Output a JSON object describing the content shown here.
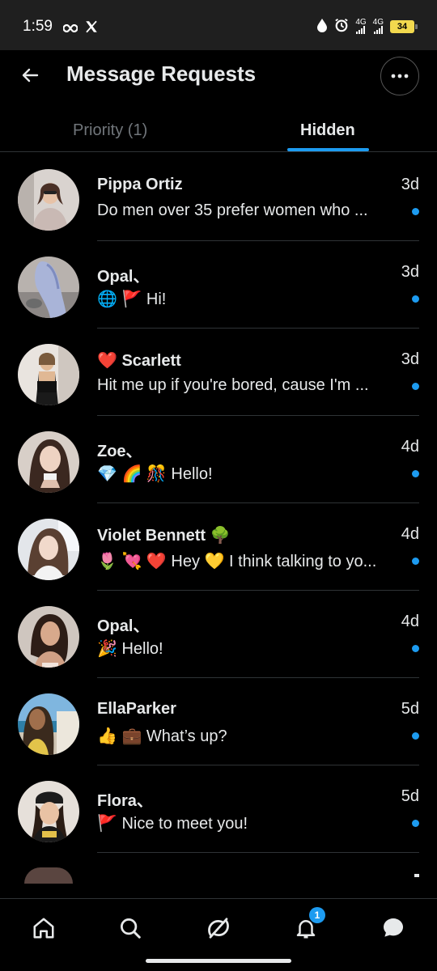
{
  "status_bar": {
    "time": "1:59",
    "network_1": "4G",
    "network_2": "4G",
    "battery": "34"
  },
  "header": {
    "title": "Message Requests"
  },
  "tabs": [
    {
      "label": "Priority (1)",
      "selected": false
    },
    {
      "label": "Hidden",
      "selected": true
    }
  ],
  "accent_color": "#1d9bf0",
  "messages": [
    {
      "name": "Pippa Ortiz",
      "time": "3d",
      "preview": "Do men over 35 prefer women who ...",
      "unread": true
    },
    {
      "name": "Opal、",
      "time": "3d",
      "preview": "🌐 🚩 Hi!",
      "unread": true
    },
    {
      "name": "❤️ Scarlett",
      "time": "3d",
      "preview": "Hit me up if you're bored, cause I'm ...",
      "unread": true
    },
    {
      "name": "Zoe、",
      "time": "4d",
      "preview": "💎 🌈 🎊 Hello!",
      "unread": true
    },
    {
      "name": "Violet Bennett 🌳",
      "time": "4d",
      "preview": "🌷 💘 ❤️ Hey 💛 I think talking to yo...",
      "unread": true
    },
    {
      "name": "Opal、",
      "time": "4d",
      "preview": "🎉 Hello!",
      "unread": true
    },
    {
      "name": "EllaParker",
      "time": "5d",
      "preview": "👍 💼 What’s up?",
      "unread": true
    },
    {
      "name": "Flora、",
      "time": "5d",
      "preview": "🚩 Nice to meet you!",
      "unread": true
    }
  ],
  "bottom_nav": {
    "items": [
      "home-icon",
      "search-icon",
      "grok-icon",
      "notifications-icon",
      "messages-icon"
    ],
    "notifications_badge": "1"
  }
}
